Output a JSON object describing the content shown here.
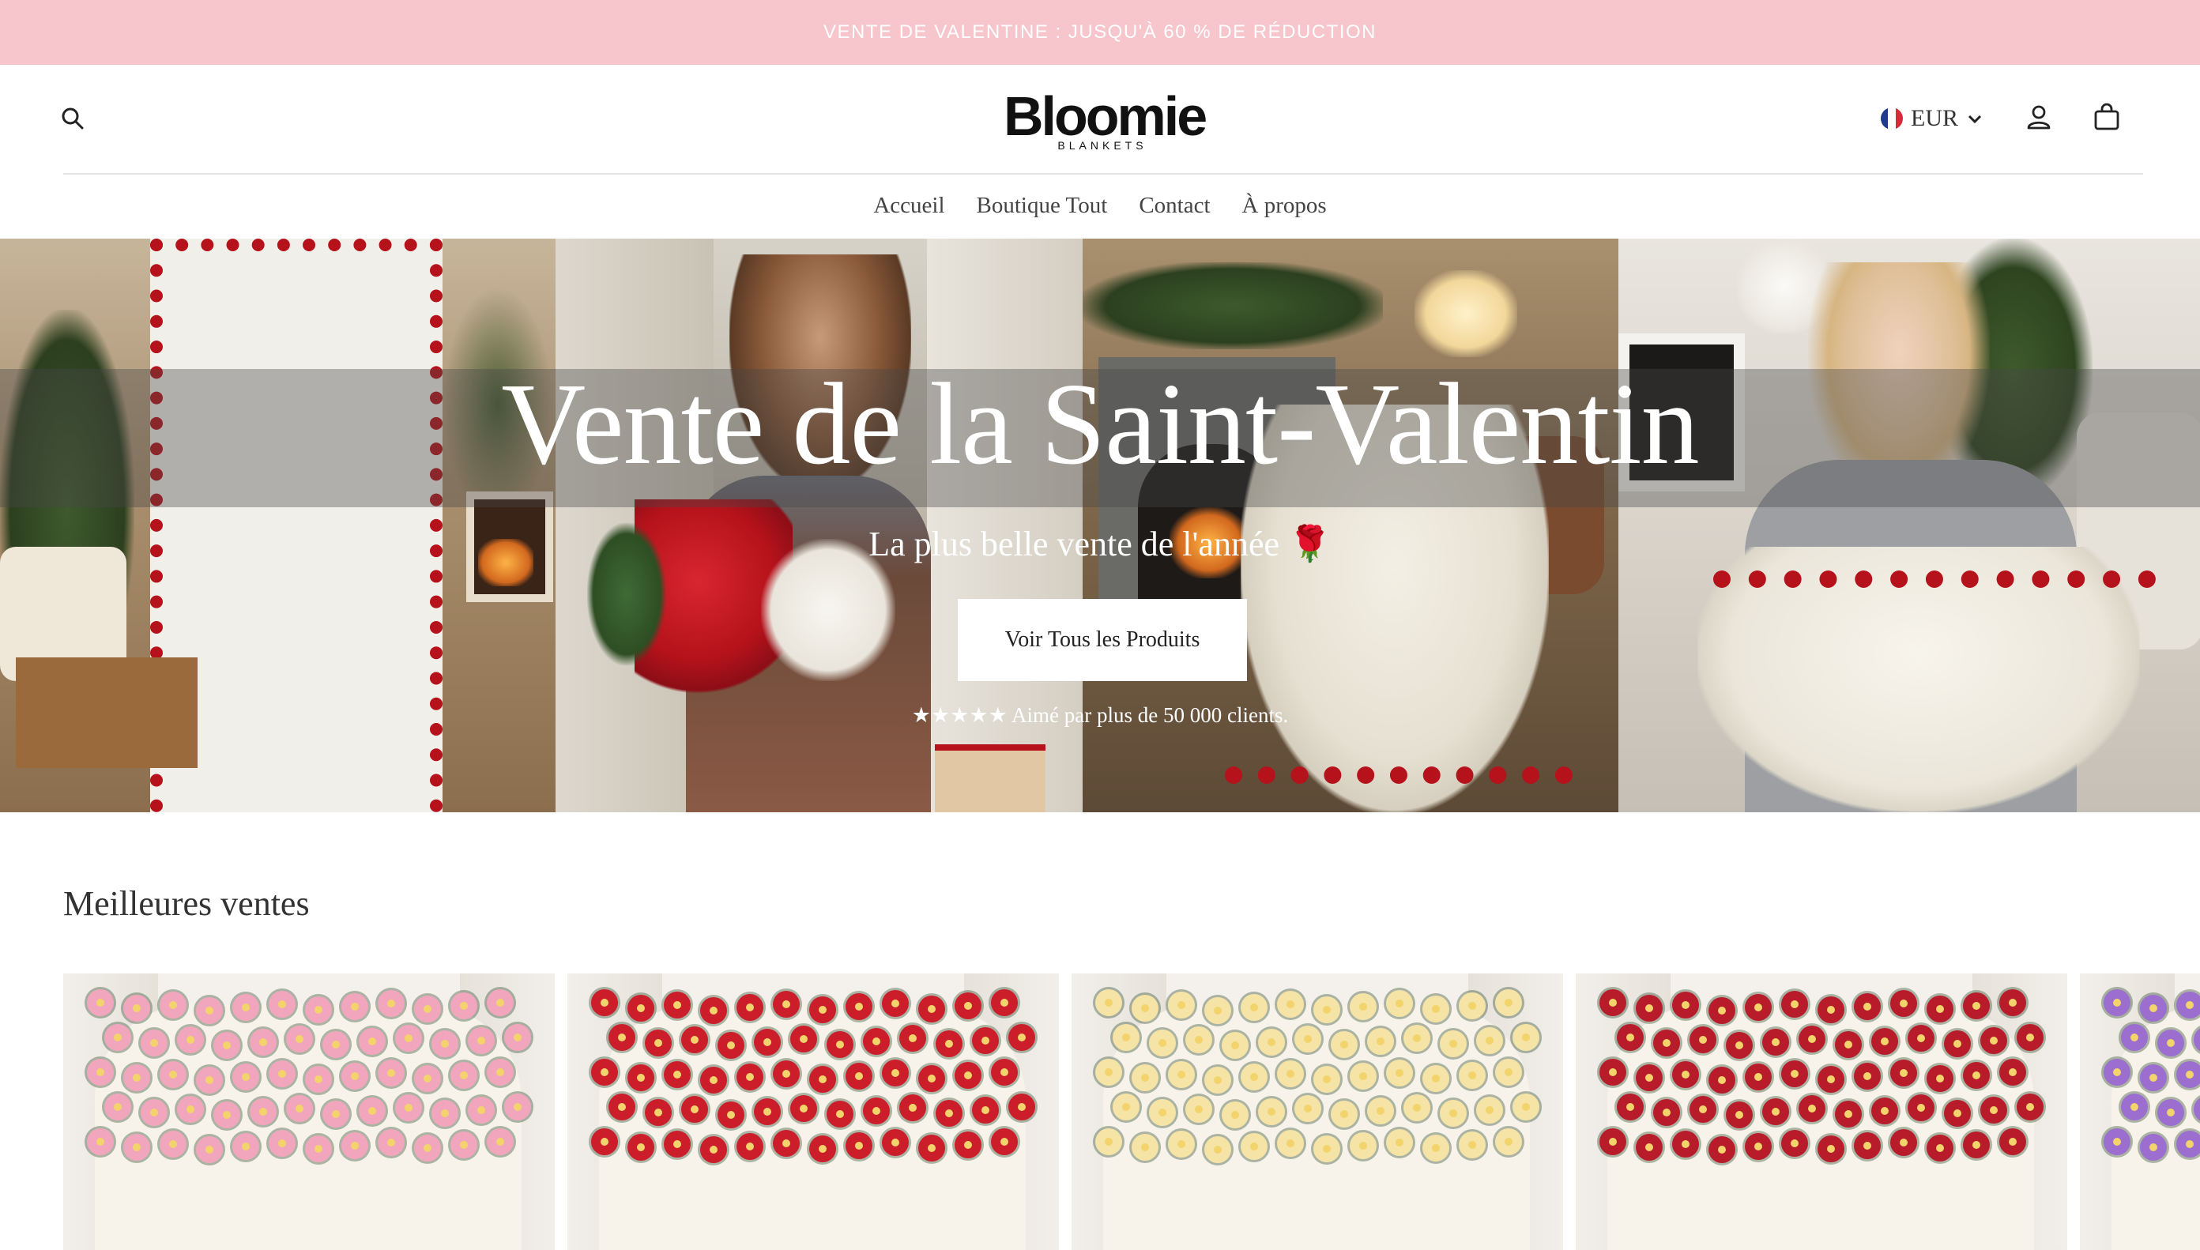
{
  "announcement": {
    "text": "VENTE DE VALENTINE : JUSQU'À 60 % DE RÉDUCTION"
  },
  "header": {
    "logo_main": "Bloomie",
    "logo_sub": "BLANKETS",
    "currency": "EUR",
    "icons": {
      "search": "search-icon",
      "account": "user-icon",
      "cart": "shopping-bag-icon",
      "currency_flag": "flag-france-icon",
      "currency_chevron": "chevron-down-icon"
    }
  },
  "nav": {
    "items": [
      {
        "label": "Accueil"
      },
      {
        "label": "Boutique Tout"
      },
      {
        "label": "Contact"
      },
      {
        "label": "À propos"
      }
    ]
  },
  "hero": {
    "title": "Vente de la Saint-Valentin",
    "subtitle": "La plus belle vente de l'année 🌹",
    "cta": "Voir Tous les Produits",
    "trust": "★★★★★ Aimé par plus de 50 000 clients."
  },
  "bestsellers": {
    "title": "Meilleures ventes",
    "products": [
      {
        "color": "#f2a6bd"
      },
      {
        "color": "#cc1d2b"
      },
      {
        "color": "#f6e3a6"
      },
      {
        "color": "#b81c2a"
      },
      {
        "color": "#9b6ed0"
      }
    ]
  },
  "colors": {
    "announcement_bg": "#f7c6cc",
    "button_bg": "#ffffff",
    "text": "#333333"
  }
}
